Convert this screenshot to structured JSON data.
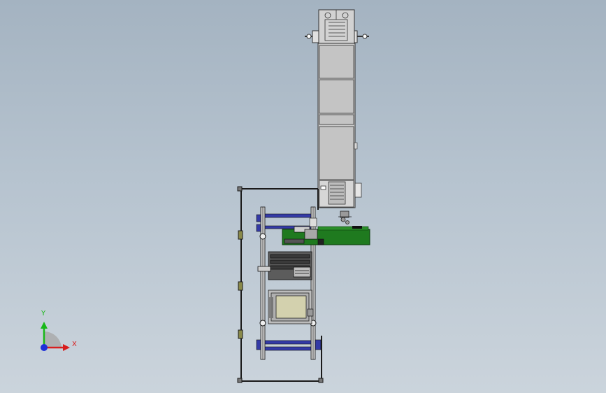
{
  "view": {
    "background_top": "#a4b3c1",
    "background_bottom": "#cbd4dc"
  },
  "triad": {
    "x_label": "X",
    "y_label": "Y",
    "x_color": "#d81e1e",
    "y_color": "#18b818",
    "z_color": "#1e2fd8"
  },
  "colors": {
    "machine_gray": "#c9c9c9",
    "machine_line": "#3a3a3a",
    "frame_blue": "#343aa6",
    "conveyor_green": "#1f7a1f",
    "plate_olive": "#d3d1ae",
    "frame_dark": "#1a1a1a"
  }
}
